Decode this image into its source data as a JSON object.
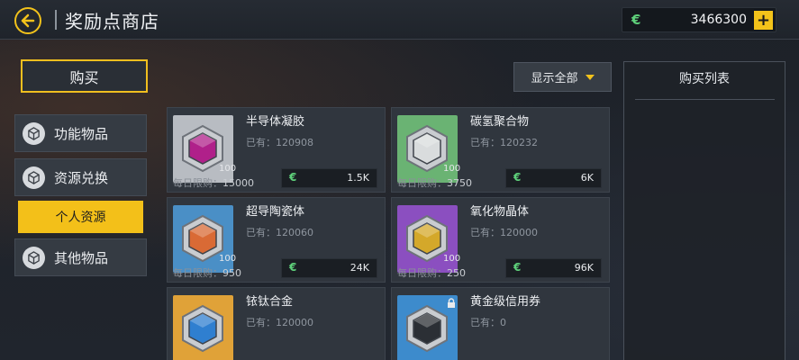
{
  "header": {
    "title": "奖励点商店",
    "currency_icon": "€",
    "currency_value": "3466300",
    "plus_label": "+"
  },
  "buy_button": "购买",
  "sidebar": {
    "items": [
      {
        "label": "功能物品",
        "icon": "cube-icon"
      },
      {
        "label": "资源兑换",
        "icon": "cube-icon"
      },
      {
        "label": "个人资源",
        "active": true
      },
      {
        "label": "其他物品",
        "icon": "cube-icon"
      }
    ]
  },
  "filter": {
    "label": "显示全部"
  },
  "buy_list": {
    "title": "购买列表"
  },
  "colors": {
    "accent": "#f3c019",
    "currency": "#5ed07a",
    "panel": "#30363e"
  },
  "items": [
    {
      "name": "半导体凝胶",
      "owned": "已有：120908",
      "stack": "100",
      "limit_label": "每日限购：",
      "limit": "15000",
      "price_icon": "€",
      "price": "1.5K",
      "thumb_bg": "#b8bcc2",
      "crystal": "#b0208a"
    },
    {
      "name": "碳氢聚合物",
      "owned": "已有：120232",
      "stack": "100",
      "limit_label": "每日限购：",
      "limit": "3750",
      "price_icon": "€",
      "price": "6K",
      "thumb_bg": "#6ab373",
      "crystal": "#d9dcdd"
    },
    {
      "name": "超导陶瓷体",
      "owned": "已有：120060",
      "stack": "100",
      "limit_label": "每日限购：",
      "limit": "950",
      "price_icon": "€",
      "price": "24K",
      "thumb_bg": "#4a8fc6",
      "crystal": "#d96a35"
    },
    {
      "name": "氧化物晶体",
      "owned": "已有：120000",
      "stack": "100",
      "limit_label": "每日限购：",
      "limit": "250",
      "price_icon": "€",
      "price": "96K",
      "thumb_bg": "#8b4fc0",
      "crystal": "#d4a82a"
    },
    {
      "name": "铱钛合金",
      "owned": "已有：120000",
      "thumb_bg": "#e0a238",
      "crystal": "#2f7fd0"
    },
    {
      "name": "黄金级信用券",
      "owned": "已有：0",
      "thumb_bg": "#3d8bcc",
      "crystal": "#2b2f35",
      "locked": true
    }
  ]
}
